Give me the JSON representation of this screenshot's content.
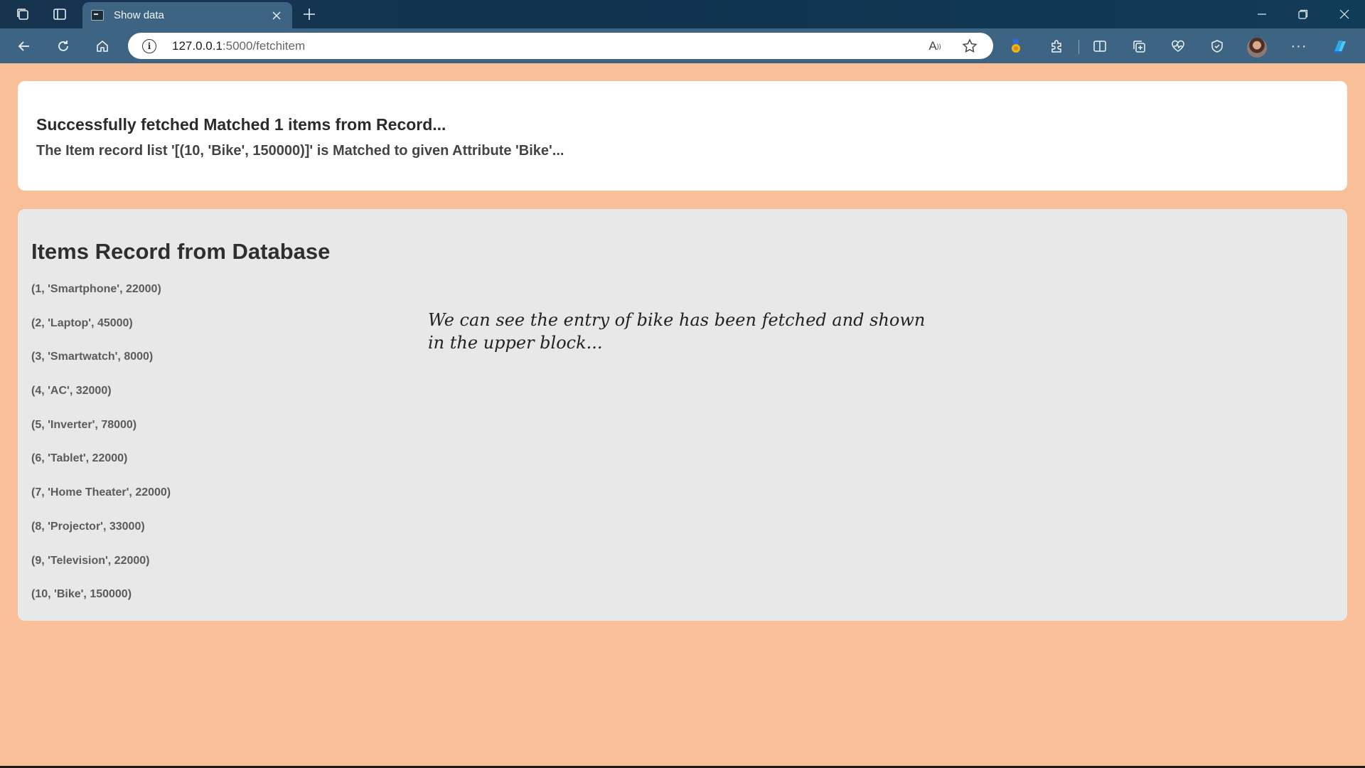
{
  "browser": {
    "tab": {
      "title": "Show data"
    },
    "address": {
      "host": "127.0.0.1",
      "rest": ":5000/fetchitem"
    }
  },
  "colors": {
    "page_background": "#f9bf98",
    "title_bar": "#17344f",
    "toolbar": "#3d6583",
    "message_card": "#ffffff",
    "records_card": "#e8e8e8"
  },
  "icons": {
    "workspaces": "workspaces-icon",
    "tab_actions": "tab-actions-icon",
    "back": "back-arrow-icon",
    "refresh": "refresh-icon",
    "home": "home-icon",
    "read_aloud": "read-aloud-icon",
    "favorite": "star-icon",
    "extensions": "puzzle-icon",
    "split_screen": "split-screen-icon",
    "collections": "collections-icon",
    "performance": "heart-pulse-icon",
    "browser_essentials": "shield-icon",
    "more": "more-icon",
    "copilot": "copilot-icon"
  },
  "message": {
    "title": "Successfully fetched Matched 1 items from Record...",
    "detail": "The Item record list '[(10, 'Bike', 150000)]' is Matched to given Attribute 'Bike'..."
  },
  "records": {
    "heading": "Items Record from Database",
    "items": [
      "(1, 'Smartphone', 22000)",
      "(2, 'Laptop', 45000)",
      "(3, 'Smartwatch', 8000)",
      "(4, 'AC', 32000)",
      "(5, 'Inverter', 78000)",
      "(6, 'Tablet', 22000)",
      "(7, 'Home Theater', 22000)",
      "(8, 'Projector', 33000)",
      "(9, 'Television', 22000)",
      "(10, 'Bike', 150000)"
    ]
  },
  "annotation": "We can see the entry of bike has been fetched and shown in the upper block..."
}
